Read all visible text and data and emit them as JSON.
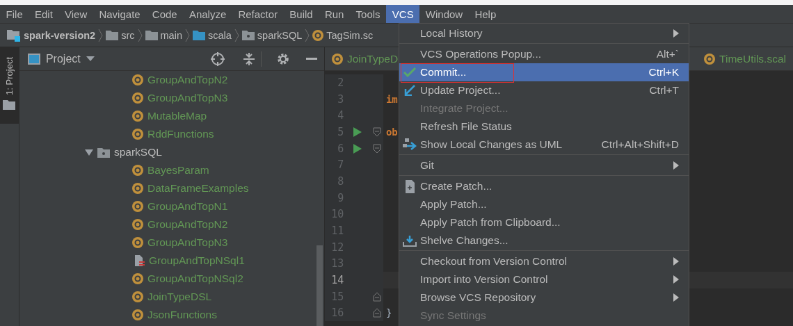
{
  "menubar": [
    {
      "label": "File",
      "selected": false
    },
    {
      "label": "Edit",
      "selected": false
    },
    {
      "label": "View",
      "selected": false
    },
    {
      "label": "Navigate",
      "selected": false
    },
    {
      "label": "Code",
      "selected": false
    },
    {
      "label": "Analyze",
      "selected": false
    },
    {
      "label": "Refactor",
      "selected": false
    },
    {
      "label": "Build",
      "selected": false
    },
    {
      "label": "Run",
      "selected": false
    },
    {
      "label": "Tools",
      "selected": false
    },
    {
      "label": "VCS",
      "selected": true
    },
    {
      "label": "Window",
      "selected": false
    },
    {
      "label": "Help",
      "selected": false
    }
  ],
  "breadcrumb": [
    {
      "label": "spark-version2",
      "kind": "module"
    },
    {
      "label": "src",
      "kind": "folder"
    },
    {
      "label": "main",
      "kind": "folder"
    },
    {
      "label": "scala",
      "kind": "source"
    },
    {
      "label": "sparkSQL",
      "kind": "package"
    },
    {
      "label": "TagSim.sc",
      "kind": "object"
    }
  ],
  "tool_strip": {
    "label": "1: Project"
  },
  "project_panel": {
    "title": "Project",
    "tree": [
      {
        "children": [
          {
            "label": "GroupAndTopN2",
            "kind": "object"
          },
          {
            "label": "GroupAndTopN3",
            "kind": "object"
          },
          {
            "label": "MutableMap",
            "kind": "object"
          },
          {
            "label": "RddFunctions",
            "kind": "object"
          }
        ]
      },
      {
        "label": "sparkSQL",
        "kind": "package",
        "expanded": true,
        "children": [
          {
            "label": "BayesParam",
            "kind": "object"
          },
          {
            "label": "DataFrameExamples",
            "kind": "object"
          },
          {
            "label": "GroupAndTopN1",
            "kind": "object"
          },
          {
            "label": "GroupAndTopN2",
            "kind": "object"
          },
          {
            "label": "GroupAndTopN3",
            "kind": "object"
          },
          {
            "label": "GroupAndTopNSql1",
            "kind": "sql"
          },
          {
            "label": "GroupAndTopNSql2",
            "kind": "object"
          },
          {
            "label": "JoinTypeDSL",
            "kind": "object"
          },
          {
            "label": "JsonFunctions",
            "kind": "object"
          }
        ]
      }
    ]
  },
  "editor": {
    "tabs": [
      {
        "label": "JoinTypeD",
        "selected": false
      },
      {
        "label": "TimeUtils.scal",
        "selected": false
      }
    ],
    "lines": [
      {
        "number": "2",
        "current": false
      },
      {
        "number": "3",
        "current": false,
        "code": {
          "text": "im",
          "kind": "keyword"
        }
      },
      {
        "number": "4",
        "current": false
      },
      {
        "number": "5",
        "current": false,
        "run": true,
        "fold_start": true,
        "code": {
          "text": "ob",
          "kind": "keyword"
        }
      },
      {
        "number": "6",
        "current": false,
        "run": true,
        "fold_start": true
      },
      {
        "number": "7",
        "current": false
      },
      {
        "number": "8",
        "current": false
      },
      {
        "number": "9",
        "current": false
      },
      {
        "number": "10",
        "current": false
      },
      {
        "number": "11",
        "current": false
      },
      {
        "number": "12",
        "current": false
      },
      {
        "number": "13",
        "current": false
      },
      {
        "number": "14",
        "current": true
      },
      {
        "number": "15",
        "current": false,
        "fold_end": true
      },
      {
        "number": "16",
        "current": false,
        "fold_end": true,
        "code": {
          "text": "}",
          "kind": "plain"
        }
      }
    ]
  },
  "vcs_menu": {
    "groups": [
      [
        {
          "label": "Local History",
          "kind": "plain",
          "submenu": true,
          "disabled": false,
          "selected": false
        }
      ],
      [
        {
          "label": "VCS Operations Popup...",
          "kind": "plain",
          "shortcut": "Alt+`",
          "submenu": false,
          "disabled": false,
          "selected": false
        },
        {
          "label": "Commit...",
          "kind": "commit",
          "shortcut": "Ctrl+K",
          "submenu": false,
          "disabled": false,
          "selected": true,
          "outlined": true
        },
        {
          "label": "Update Project...",
          "kind": "update",
          "shortcut": "Ctrl+T",
          "submenu": false,
          "disabled": false,
          "selected": false
        },
        {
          "label": "Integrate Project...",
          "kind": "plain",
          "submenu": false,
          "disabled": true,
          "selected": false
        },
        {
          "label": "Refresh File Status",
          "kind": "plain",
          "submenu": false,
          "disabled": false,
          "selected": false
        },
        {
          "label": "Show Local Changes as UML",
          "kind": "uml",
          "shortcut": "Ctrl+Alt+Shift+D",
          "submenu": false,
          "disabled": false,
          "selected": false
        }
      ],
      [
        {
          "label": "Git",
          "kind": "plain",
          "submenu": true,
          "disabled": false,
          "selected": false
        }
      ],
      [
        {
          "label": "Create Patch...",
          "kind": "patch",
          "submenu": false,
          "disabled": false,
          "selected": false
        },
        {
          "label": "Apply Patch...",
          "kind": "plain",
          "submenu": false,
          "disabled": false,
          "selected": false
        },
        {
          "label": "Apply Patch from Clipboard...",
          "kind": "plain",
          "submenu": false,
          "disabled": false,
          "selected": false
        },
        {
          "label": "Shelve Changes...",
          "kind": "shelve",
          "submenu": false,
          "disabled": false,
          "selected": false
        }
      ],
      [
        {
          "label": "Checkout from Version Control",
          "kind": "plain",
          "submenu": true,
          "disabled": false,
          "selected": false
        },
        {
          "label": "Import into Version Control",
          "kind": "plain",
          "submenu": true,
          "disabled": false,
          "selected": false
        },
        {
          "label": "Browse VCS Repository",
          "kind": "plain",
          "submenu": true,
          "disabled": false,
          "selected": false
        },
        {
          "label": "Sync Settings",
          "kind": "plain",
          "submenu": false,
          "disabled": true,
          "selected": false
        }
      ]
    ]
  }
}
